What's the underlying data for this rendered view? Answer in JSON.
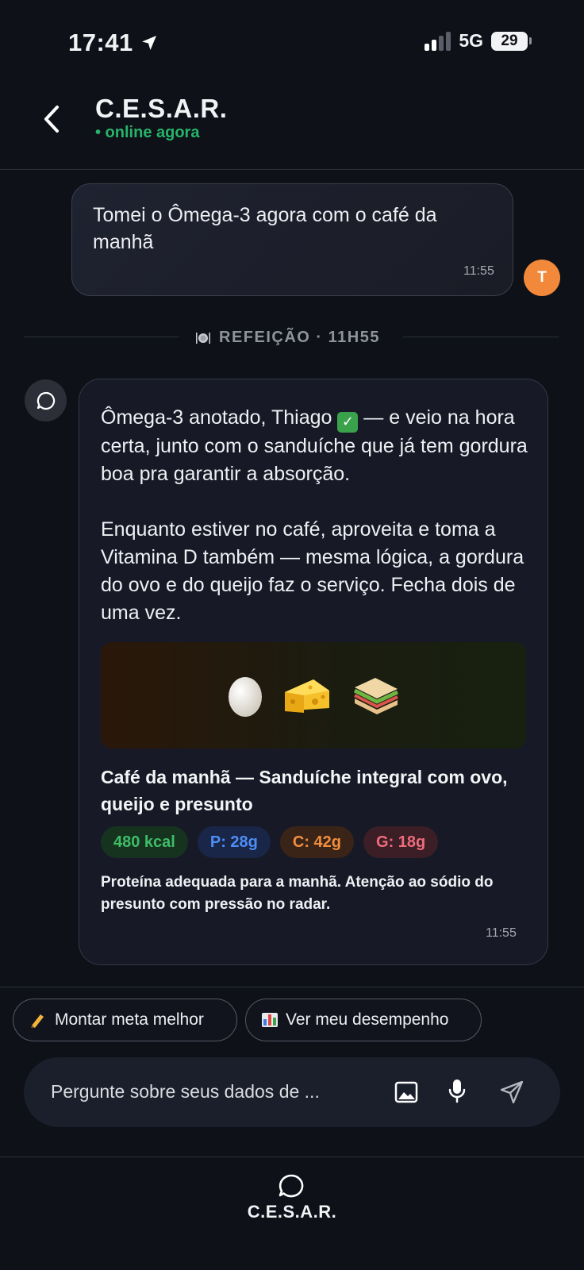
{
  "status_bar": {
    "time": "17:41",
    "network": "5G",
    "battery": "29"
  },
  "header": {
    "title": "C.E.S.A.R.",
    "status": "• online agora"
  },
  "user_message": {
    "text": "Tomei o Ômega-3 agora com o café da manhã",
    "time": "11:55",
    "avatar_initial": "T"
  },
  "divider": {
    "label": "REFEIÇÃO · 11H55"
  },
  "bot_message": {
    "p1_before": "Ômega-3 anotado, Thiago",
    "p1_after": " — e veio na hora certa, junto com o sanduíche que já tem gordura boa pra garantir a absorção.",
    "p2": "Enquanto estiver no café, aproveita e toma a Vitamina D também — mesma lógica, a gordura do ovo e do queijo faz o serviço. Fecha dois de uma vez.",
    "meal_title": "Café da manhã — Sanduíche integral com ovo, queijo e presunto",
    "chips": {
      "kcal": "480 kcal",
      "protein": "P: 28g",
      "carbs": "C: 42g",
      "fat": "G: 18g"
    },
    "note": "Proteína adequada para a manhã. Atenção ao sódio do presunto com pressão no radar.",
    "time": "11:55",
    "food_icons": [
      "egg-icon",
      "cheese-icon",
      "sandwich-icon"
    ]
  },
  "suggestions": [
    {
      "label": "Montar meta melhor",
      "icon": "writing-hand-icon"
    },
    {
      "label": "Ver meu desempenho",
      "icon": "bar-chart-icon"
    }
  ],
  "input": {
    "placeholder": "Pergunte sobre seus dados de ..."
  },
  "bottom_nav": {
    "label": "C.E.S.A.R."
  },
  "colors": {
    "background": "#0e1118",
    "online_green": "#27b46a",
    "avatar_orange": "#f2883a",
    "kcal_green": "#3ebd67",
    "protein_blue": "#4d8ef5",
    "carbs_orange": "#f08e3e",
    "fat_red": "#ef6c7a"
  }
}
